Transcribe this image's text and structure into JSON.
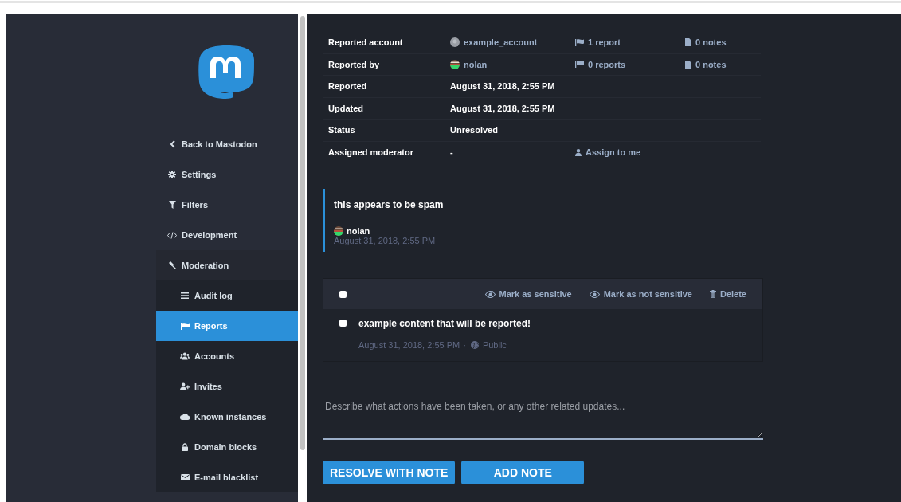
{
  "sidebar": {
    "items": [
      {
        "label": "Back to Mastodon",
        "kind": "back",
        "selected": false
      },
      {
        "label": "Settings",
        "kind": "settings",
        "selected": false
      },
      {
        "label": "Filters",
        "kind": "filter",
        "selected": false
      },
      {
        "label": "Development",
        "kind": "code",
        "selected": false
      },
      {
        "label": "Moderation",
        "kind": "gavel",
        "selected": false,
        "expanded": true,
        "children": [
          {
            "label": "Audit log",
            "kind": "list",
            "selected": false
          },
          {
            "label": "Reports",
            "kind": "flag",
            "selected": true
          },
          {
            "label": "Accounts",
            "kind": "users",
            "selected": false
          },
          {
            "label": "Invites",
            "kind": "user-plus",
            "selected": false
          },
          {
            "label": "Known instances",
            "kind": "cloud",
            "selected": false
          },
          {
            "label": "Domain blocks",
            "kind": "lock",
            "selected": false
          },
          {
            "label": "E-mail blacklist",
            "kind": "envelope",
            "selected": false
          }
        ]
      }
    ]
  },
  "details": {
    "rows": [
      {
        "label": "Reported account",
        "value": "example_account",
        "avatar": {
          "kind": "default"
        },
        "reports": "1 report",
        "notes": "0 notes"
      },
      {
        "label": "Reported by",
        "value": "nolan",
        "avatar": {
          "kind": "custom"
        },
        "reports": "0 reports",
        "notes": "0 notes"
      },
      {
        "label": "Reported",
        "value": "August 31, 2018, 2:55 PM"
      },
      {
        "label": "Updated",
        "value": "August 31, 2018, 2:55 PM"
      },
      {
        "label": "Status",
        "value": "Unresolved"
      },
      {
        "label": "Assigned moderator",
        "value": "-",
        "action": "Assign to me"
      }
    ]
  },
  "report_comment": {
    "text": "this appears to be spam",
    "author": "nolan",
    "avatar": {
      "kind": "custom"
    },
    "time": "August 31, 2018, 2:55 PM"
  },
  "statuses": {
    "select_all_checked": false,
    "actions": [
      {
        "label": "Mark as sensitive",
        "kind": "eye-slash"
      },
      {
        "label": "Mark as not sensitive",
        "kind": "eye"
      },
      {
        "label": "Delete",
        "kind": "trash"
      }
    ],
    "items": [
      {
        "checked": false,
        "content": "example content that will be reported!",
        "time": "August 31, 2018, 2:55 PM",
        "separator": "·",
        "visibility": "Public"
      }
    ]
  },
  "note_form": {
    "placeholder": "Describe what actions have been taken, or any other related updates...",
    "buttons": [
      "RESOLVE WITH NOTE",
      "ADD NOTE"
    ]
  }
}
